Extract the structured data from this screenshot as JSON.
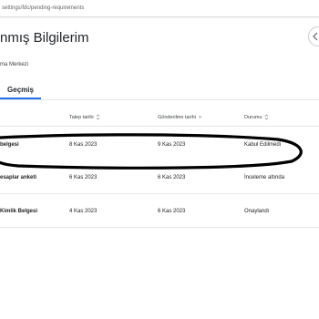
{
  "browser": {
    "url": "settings/fdc/pending-requirements"
  },
  "page": {
    "title": "nmış Bilgilerim",
    "subtitle": "ma Merkezi"
  },
  "tabs": [
    {
      "label": "Geçmiş",
      "active": true
    }
  ],
  "table": {
    "columns": [
      "Talep tarihi",
      "Gönderilme tarihi",
      "Durumu"
    ],
    "rows": [
      {
        "name": "belgesi",
        "requested": "8 Kas 2023",
        "sent": "9 Kas 2023",
        "status": "Kabul Edilmedi"
      },
      {
        "name": "esaplar anketi",
        "requested": "6 Kas 2023",
        "sent": "6 Kas 2023",
        "status": "İnceleme altında"
      },
      {
        "name": "Kimlik Belgesi",
        "requested": "4 Kas 2023",
        "sent": "6 Kas 2023",
        "status": "Onaylandı"
      }
    ]
  },
  "colors": {
    "tab_underline": "#1f6feb",
    "annotation_ink": "#000000"
  }
}
